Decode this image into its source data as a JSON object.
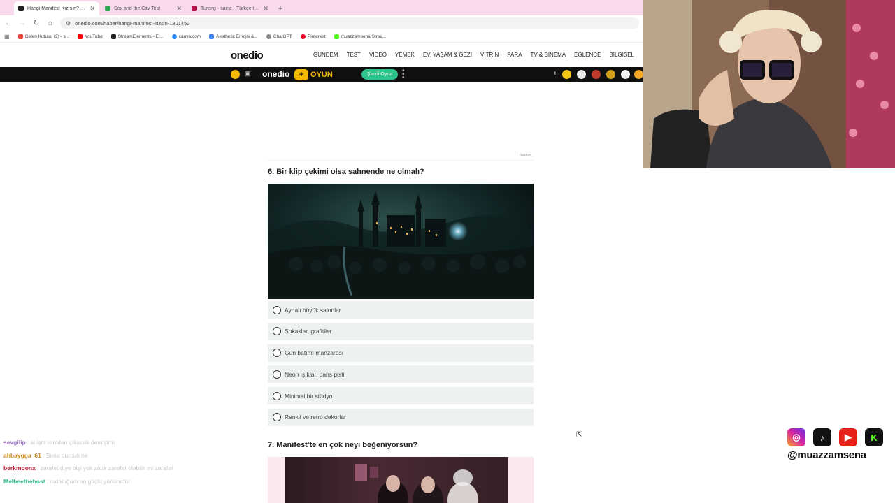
{
  "browser": {
    "tabs": [
      {
        "title": "Hangi Manifest Kızısın? Onedi",
        "favicon_color": "#222222",
        "active": true
      },
      {
        "title": "Sex and the City Test",
        "favicon_color": "#34a853",
        "active": false
      },
      {
        "title": "Tureng - saine - Türkçe İngilizc",
        "favicon_color": "#b5124a",
        "active": false
      }
    ],
    "new_tab": "+",
    "url": "onedio.com/haber/hangi-manifest-kizsin-1301452",
    "bookmarks": [
      {
        "label": "Gelen Kutusu (2) - s...",
        "color": "#ea4335"
      },
      {
        "label": "YouTube",
        "color": "#ff0000"
      },
      {
        "label": "StreamElements - El...",
        "color": "#222222"
      },
      {
        "label": "canva.com",
        "color": "#2d8cff"
      },
      {
        "label": "Aesthetic Emojis &...",
        "color": "#3b82f6"
      },
      {
        "label": "ChatGPT",
        "color": "#888888"
      },
      {
        "label": "Pinterest",
        "color": "#e60023"
      },
      {
        "label": "muazzamsena Strea...",
        "color": "#53fc18"
      }
    ]
  },
  "site": {
    "logo": "onedio",
    "nav": [
      "GÜNDEM",
      "TEST",
      "VİDEO",
      "YEMEK",
      "EV, YAŞAM & GEZİ",
      "VİTRİN",
      "PARA",
      "TV & SİNEMA",
      "EĞLENCE",
      "BİLGİSEL"
    ],
    "gamebar": {
      "logo": "onedio",
      "plus": "+",
      "oyun": "OYUN",
      "play_label": "Şimdi Oyna"
    }
  },
  "content": {
    "ad_label": "Reklam",
    "question6": {
      "title": "6. Bir klip çekimi olsa sahnende ne olmalı?",
      "options": [
        "Aynalı büyük salonlar",
        "Sokaklar, grafitiler",
        "Gün batımı manzarası",
        "Neon ışıklar, dans pisti",
        "Minimal bir stüdyo",
        "Renkli ve retro dekorlar"
      ]
    },
    "question7": {
      "title": "7. Manifest'te en çok neyi beğeniyorsun?"
    }
  },
  "chat": [
    {
      "user": "sevgilip",
      "message": ": al işte renkten çıkacak demiştim",
      "color": "#9b6fc7"
    },
    {
      "user": "ahbaygga_61",
      "message": ": Sena burcun ne",
      "color": "#c98a1a"
    },
    {
      "user": "berkmoonx",
      "message": ": zarafet diye bişi yok zatık zarafet olabilir mi zarafet",
      "color": "#b5122b"
    },
    {
      "user": "Melbeethehost",
      "message": ": rudeluğum en güçlü yönümdür",
      "color": "#2fb58f"
    }
  ],
  "socials": {
    "handle": "@muazzamsena",
    "icons": [
      {
        "name": "instagram",
        "glyph": "◎",
        "color": "#d6249f"
      },
      {
        "name": "tiktok",
        "glyph": "♪",
        "color": "#111111"
      },
      {
        "name": "youtube",
        "glyph": "▶",
        "color": "#e62117"
      },
      {
        "name": "kick",
        "glyph": "K",
        "color": "#111111"
      }
    ]
  }
}
